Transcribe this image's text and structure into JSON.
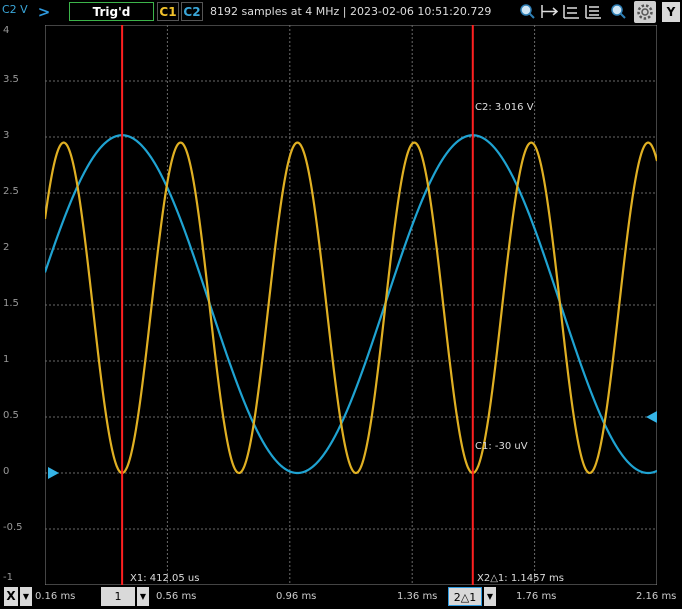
{
  "toolbar": {
    "y_axis_channel": "C2 V",
    "trigger_status": "Trig'd",
    "c1_label": "C1",
    "c2_label": "C2",
    "acquisition_info": "8192 samples at 4 MHz | 2023-02-06 10:51:20.729",
    "y_button": "Y",
    "icons": [
      "zoom-fit-icon",
      "zoom-x-icon",
      "zoom-y-icon",
      "zoom-xy-icon",
      "zoom-in-icon",
      "settings-icon"
    ]
  },
  "y_axis": {
    "ticks": [
      "4",
      "3.5",
      "3",
      "2.5",
      "2",
      "1.5",
      "1",
      "0.5",
      "0",
      "-0.5",
      "-1"
    ]
  },
  "x_axis": {
    "x_button": "X",
    "ticks": [
      "0.16 ms",
      "0.56 ms",
      "0.96 ms",
      "1.36 ms",
      "1.76 ms",
      "2.16 ms"
    ],
    "cursor1_select": "1",
    "cursor2_select": "2△1"
  },
  "cursors": {
    "x1_label": "X1: 412.05 us",
    "x2_label": "X2△1: 1.1457 ms",
    "c2_readout": "C2: 3.016 V",
    "c1_readout": "C1: -30 uV"
  },
  "colors": {
    "c1": "#e0b023",
    "c2": "#1fa3d2",
    "cursor": "#ff2020",
    "grid": "#6a6a6a",
    "ui_blue": "#2f9be0"
  },
  "chart_data": {
    "type": "line",
    "x_unit": "ms",
    "y_unit": "V",
    "xlim": [
      0.16,
      2.16
    ],
    "ylim": [
      -1,
      4
    ],
    "series": [
      {
        "name": "C1",
        "waveform": "sine",
        "period_ms": 0.382,
        "min": 0,
        "max": 2.95,
        "min_at_ms": 0.412
      },
      {
        "name": "C2",
        "waveform": "sine",
        "period_ms": 1.146,
        "min": 0,
        "max": 3.016,
        "max_at_ms": 0.412
      }
    ],
    "cursors_x_ms": [
      0.412,
      1.558
    ]
  }
}
